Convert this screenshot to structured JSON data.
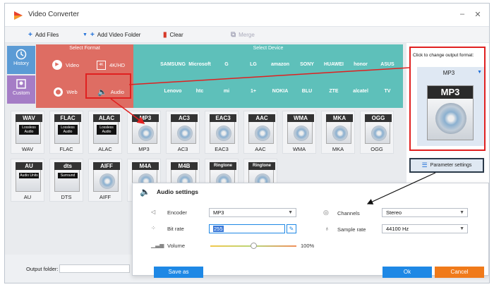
{
  "app": {
    "title": "Video Converter"
  },
  "toolbar": {
    "add_files": "Add Files",
    "add_video_folder": "Add Video Folder",
    "clear": "Clear",
    "merge": "Merge"
  },
  "categories": {
    "history": "History",
    "custom": "Custom"
  },
  "select_format": {
    "header": "Select Format",
    "video": "Video",
    "hd": "4K/HD",
    "web": "Web",
    "audio": "Audio"
  },
  "select_device": {
    "header": "Select Device",
    "brands_row1": [
      "SAMSUNG",
      "Microsoft",
      "G",
      "LG",
      "amazon",
      "SONY",
      "HUAWEI",
      "honor",
      "ASUS"
    ],
    "brands_row2": [
      "Lenovo",
      "htc",
      "mi",
      "1+",
      "NOKIA",
      "BLU",
      "ZTE",
      "alcatel",
      "TV"
    ]
  },
  "formats_row1": [
    {
      "tag": "WAV",
      "sub": "Lossless Audio",
      "label": "WAV"
    },
    {
      "tag": "FLAC",
      "sub": "Lossless Audio",
      "label": "FLAC"
    },
    {
      "tag": "ALAC",
      "sub": "Lossless Audio",
      "label": "ALAC"
    },
    {
      "tag": "MP3",
      "sub": "",
      "label": "MP3"
    },
    {
      "tag": "AC3",
      "sub": "",
      "label": "AC3"
    },
    {
      "tag": "EAC3",
      "sub": "",
      "label": "EAC3"
    },
    {
      "tag": "AAC",
      "sub": "",
      "label": "AAC"
    },
    {
      "tag": "WMA",
      "sub": "",
      "label": "WMA"
    },
    {
      "tag": "MKA",
      "sub": "",
      "label": "MKA"
    },
    {
      "tag": "OGG",
      "sub": "",
      "label": "OGG"
    }
  ],
  "formats_row2": [
    {
      "tag": "AU",
      "sub": "Audio Units",
      "label": "AU"
    },
    {
      "tag": "dts",
      "sub": "Surround",
      "label": "DTS"
    },
    {
      "tag": "AIFF",
      "sub": "",
      "label": "AIFF"
    },
    {
      "tag": "M4A",
      "sub": "",
      "label": ""
    },
    {
      "tag": "M4B",
      "sub": "",
      "label": ""
    },
    {
      "tag": "Ringtone",
      "sub": "",
      "label": ""
    },
    {
      "tag": "Ringtone",
      "sub": "",
      "label": ""
    }
  ],
  "output_format": {
    "hint": "Click to change output format:",
    "current": "MP3",
    "card_label": "MP3"
  },
  "parameter_settings": "Parameter settings",
  "audio_settings": {
    "title": "Audio settings",
    "encoder_label": "Encoder",
    "encoder_value": "MP3",
    "bitrate_label": "Bit rate",
    "bitrate_value": "255",
    "volume_label": "Volume",
    "volume_value": "100%",
    "volume_level": 0.5,
    "channels_label": "Channels",
    "channels_value": "Stereo",
    "sample_rate_label": "Sample rate",
    "sample_rate_value": "44100 Hz",
    "save_as": "Save as",
    "ok": "Ok",
    "cancel": "Cancel"
  },
  "output_folder_label": "Output folder:",
  "colors": {
    "format_red": "#de6d63",
    "device_teal": "#5ec0ba",
    "accent_blue": "#1e88e5",
    "cancel_orange": "#f07a1a",
    "highlight_red": "#e02020"
  }
}
